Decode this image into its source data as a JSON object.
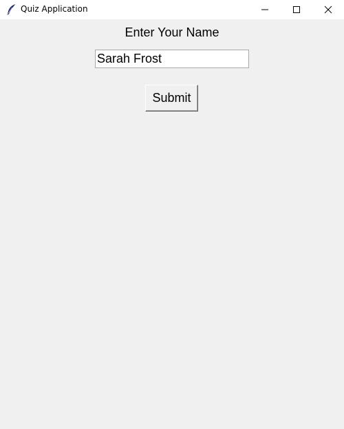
{
  "window": {
    "title": "Quiz Application",
    "app_icon": "feather-icon",
    "controls": {
      "minimize_icon": "minimize-icon",
      "maximize_icon": "maximize-icon",
      "close_icon": "close-icon"
    }
  },
  "form": {
    "prompt_label": "Enter Your Name",
    "name_value": "Sarah Frost",
    "submit_label": "Submit"
  },
  "colors": {
    "background": "#f0f0f0",
    "titlebar": "#ffffff",
    "entry_background": "#ffffff",
    "text": "#000000"
  }
}
